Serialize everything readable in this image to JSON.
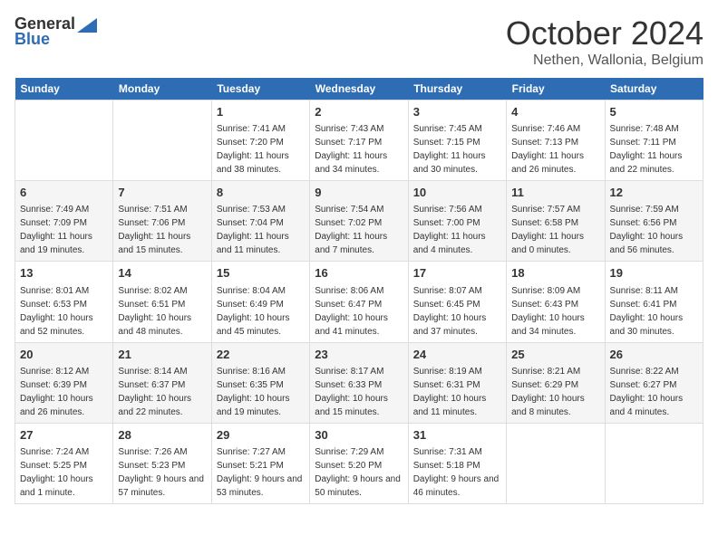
{
  "logo": {
    "general": "General",
    "blue": "Blue"
  },
  "title": {
    "month": "October 2024",
    "location": "Nethen, Wallonia, Belgium"
  },
  "headers": [
    "Sunday",
    "Monday",
    "Tuesday",
    "Wednesday",
    "Thursday",
    "Friday",
    "Saturday"
  ],
  "weeks": [
    [
      {
        "day": "",
        "sunrise": "",
        "sunset": "",
        "daylight": ""
      },
      {
        "day": "",
        "sunrise": "",
        "sunset": "",
        "daylight": ""
      },
      {
        "day": "1",
        "sunrise": "Sunrise: 7:41 AM",
        "sunset": "Sunset: 7:20 PM",
        "daylight": "Daylight: 11 hours and 38 minutes."
      },
      {
        "day": "2",
        "sunrise": "Sunrise: 7:43 AM",
        "sunset": "Sunset: 7:17 PM",
        "daylight": "Daylight: 11 hours and 34 minutes."
      },
      {
        "day": "3",
        "sunrise": "Sunrise: 7:45 AM",
        "sunset": "Sunset: 7:15 PM",
        "daylight": "Daylight: 11 hours and 30 minutes."
      },
      {
        "day": "4",
        "sunrise": "Sunrise: 7:46 AM",
        "sunset": "Sunset: 7:13 PM",
        "daylight": "Daylight: 11 hours and 26 minutes."
      },
      {
        "day": "5",
        "sunrise": "Sunrise: 7:48 AM",
        "sunset": "Sunset: 7:11 PM",
        "daylight": "Daylight: 11 hours and 22 minutes."
      }
    ],
    [
      {
        "day": "6",
        "sunrise": "Sunrise: 7:49 AM",
        "sunset": "Sunset: 7:09 PM",
        "daylight": "Daylight: 11 hours and 19 minutes."
      },
      {
        "day": "7",
        "sunrise": "Sunrise: 7:51 AM",
        "sunset": "Sunset: 7:06 PM",
        "daylight": "Daylight: 11 hours and 15 minutes."
      },
      {
        "day": "8",
        "sunrise": "Sunrise: 7:53 AM",
        "sunset": "Sunset: 7:04 PM",
        "daylight": "Daylight: 11 hours and 11 minutes."
      },
      {
        "day": "9",
        "sunrise": "Sunrise: 7:54 AM",
        "sunset": "Sunset: 7:02 PM",
        "daylight": "Daylight: 11 hours and 7 minutes."
      },
      {
        "day": "10",
        "sunrise": "Sunrise: 7:56 AM",
        "sunset": "Sunset: 7:00 PM",
        "daylight": "Daylight: 11 hours and 4 minutes."
      },
      {
        "day": "11",
        "sunrise": "Sunrise: 7:57 AM",
        "sunset": "Sunset: 6:58 PM",
        "daylight": "Daylight: 11 hours and 0 minutes."
      },
      {
        "day": "12",
        "sunrise": "Sunrise: 7:59 AM",
        "sunset": "Sunset: 6:56 PM",
        "daylight": "Daylight: 10 hours and 56 minutes."
      }
    ],
    [
      {
        "day": "13",
        "sunrise": "Sunrise: 8:01 AM",
        "sunset": "Sunset: 6:53 PM",
        "daylight": "Daylight: 10 hours and 52 minutes."
      },
      {
        "day": "14",
        "sunrise": "Sunrise: 8:02 AM",
        "sunset": "Sunset: 6:51 PM",
        "daylight": "Daylight: 10 hours and 48 minutes."
      },
      {
        "day": "15",
        "sunrise": "Sunrise: 8:04 AM",
        "sunset": "Sunset: 6:49 PM",
        "daylight": "Daylight: 10 hours and 45 minutes."
      },
      {
        "day": "16",
        "sunrise": "Sunrise: 8:06 AM",
        "sunset": "Sunset: 6:47 PM",
        "daylight": "Daylight: 10 hours and 41 minutes."
      },
      {
        "day": "17",
        "sunrise": "Sunrise: 8:07 AM",
        "sunset": "Sunset: 6:45 PM",
        "daylight": "Daylight: 10 hours and 37 minutes."
      },
      {
        "day": "18",
        "sunrise": "Sunrise: 8:09 AM",
        "sunset": "Sunset: 6:43 PM",
        "daylight": "Daylight: 10 hours and 34 minutes."
      },
      {
        "day": "19",
        "sunrise": "Sunrise: 8:11 AM",
        "sunset": "Sunset: 6:41 PM",
        "daylight": "Daylight: 10 hours and 30 minutes."
      }
    ],
    [
      {
        "day": "20",
        "sunrise": "Sunrise: 8:12 AM",
        "sunset": "Sunset: 6:39 PM",
        "daylight": "Daylight: 10 hours and 26 minutes."
      },
      {
        "day": "21",
        "sunrise": "Sunrise: 8:14 AM",
        "sunset": "Sunset: 6:37 PM",
        "daylight": "Daylight: 10 hours and 22 minutes."
      },
      {
        "day": "22",
        "sunrise": "Sunrise: 8:16 AM",
        "sunset": "Sunset: 6:35 PM",
        "daylight": "Daylight: 10 hours and 19 minutes."
      },
      {
        "day": "23",
        "sunrise": "Sunrise: 8:17 AM",
        "sunset": "Sunset: 6:33 PM",
        "daylight": "Daylight: 10 hours and 15 minutes."
      },
      {
        "day": "24",
        "sunrise": "Sunrise: 8:19 AM",
        "sunset": "Sunset: 6:31 PM",
        "daylight": "Daylight: 10 hours and 11 minutes."
      },
      {
        "day": "25",
        "sunrise": "Sunrise: 8:21 AM",
        "sunset": "Sunset: 6:29 PM",
        "daylight": "Daylight: 10 hours and 8 minutes."
      },
      {
        "day": "26",
        "sunrise": "Sunrise: 8:22 AM",
        "sunset": "Sunset: 6:27 PM",
        "daylight": "Daylight: 10 hours and 4 minutes."
      }
    ],
    [
      {
        "day": "27",
        "sunrise": "Sunrise: 7:24 AM",
        "sunset": "Sunset: 5:25 PM",
        "daylight": "Daylight: 10 hours and 1 minute."
      },
      {
        "day": "28",
        "sunrise": "Sunrise: 7:26 AM",
        "sunset": "Sunset: 5:23 PM",
        "daylight": "Daylight: 9 hours and 57 minutes."
      },
      {
        "day": "29",
        "sunrise": "Sunrise: 7:27 AM",
        "sunset": "Sunset: 5:21 PM",
        "daylight": "Daylight: 9 hours and 53 minutes."
      },
      {
        "day": "30",
        "sunrise": "Sunrise: 7:29 AM",
        "sunset": "Sunset: 5:20 PM",
        "daylight": "Daylight: 9 hours and 50 minutes."
      },
      {
        "day": "31",
        "sunrise": "Sunrise: 7:31 AM",
        "sunset": "Sunset: 5:18 PM",
        "daylight": "Daylight: 9 hours and 46 minutes."
      },
      {
        "day": "",
        "sunrise": "",
        "sunset": "",
        "daylight": ""
      },
      {
        "day": "",
        "sunrise": "",
        "sunset": "",
        "daylight": ""
      }
    ]
  ]
}
